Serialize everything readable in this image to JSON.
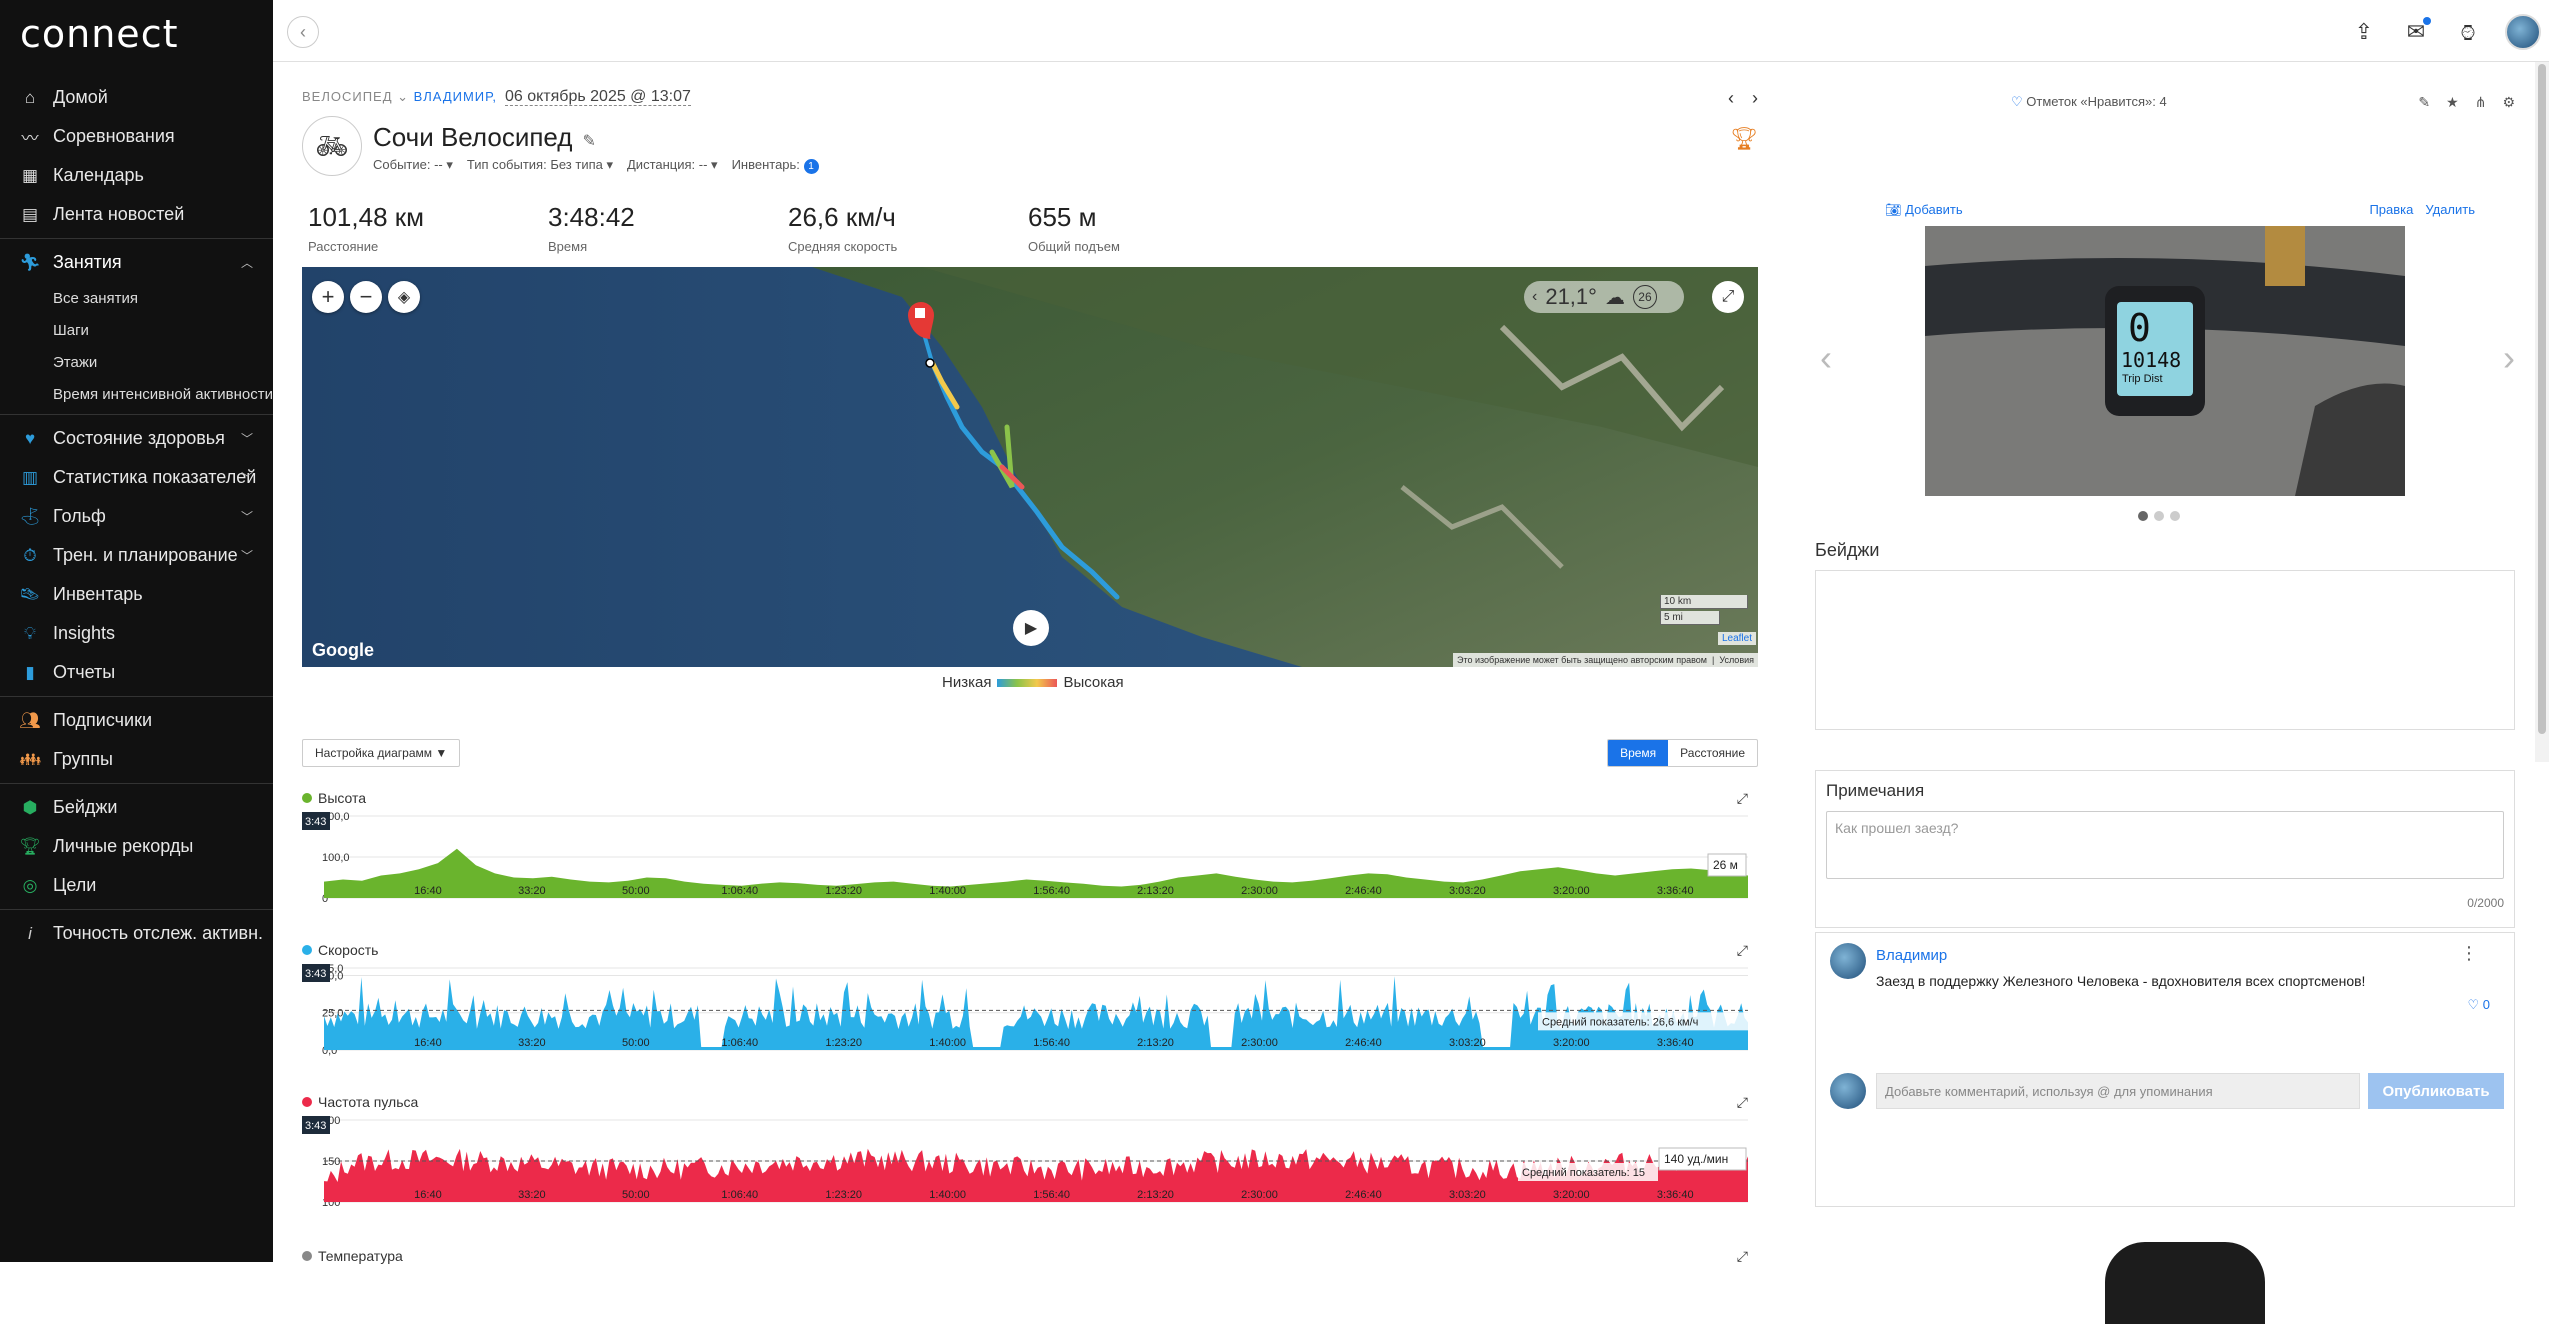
{
  "app": {
    "logo": "connect"
  },
  "nav": {
    "items": [
      {
        "icon": "home-icon",
        "label": "Домой"
      },
      {
        "icon": "challenges-icon",
        "label": "Соревнования"
      },
      {
        "icon": "calendar-icon",
        "label": "Календарь"
      },
      {
        "icon": "newsfeed-icon",
        "label": "Лента новостей"
      }
    ],
    "activities": {
      "label": "Занятия",
      "sub": [
        "Все занятия",
        "Шаги",
        "Этажи",
        "Время интенсивной активности"
      ]
    },
    "group2": [
      {
        "label": "Состояние здоровья",
        "chev": true
      },
      {
        "label": "Статистика показателей",
        "chev": true
      },
      {
        "label": "Гольф",
        "chev": true
      },
      {
        "label": "Трен. и планирование",
        "chev": true
      },
      {
        "label": "Инвентарь"
      },
      {
        "label": "Insights"
      },
      {
        "label": "Отчеты"
      }
    ],
    "group3": [
      {
        "label": "Подписчики"
      },
      {
        "label": "Группы"
      }
    ],
    "group4": [
      {
        "label": "Бейджи"
      },
      {
        "label": "Личные рекорды"
      },
      {
        "label": "Цели"
      }
    ],
    "group5": [
      {
        "label": "Точность отслеж. активн."
      }
    ]
  },
  "activity": {
    "category": "ВЕЛОСИПЕД",
    "user": "ВЛАДИМИР,",
    "date": "06 октябрь 2025 @ 13:07",
    "title": "Сочи Велосипед",
    "event_label": "Событие: --",
    "event_type": "Тип события: Без типа",
    "distance_meta": "Дистанция: --",
    "gear_label": "Инвентарь:",
    "gear_count": "1"
  },
  "stats": [
    {
      "value": "101,48 км",
      "label": "Расстояние"
    },
    {
      "value": "3:48:42",
      "label": "Время"
    },
    {
      "value": "26,6 км/ч",
      "label": "Средняя скорость"
    },
    {
      "value": "655 м",
      "label": "Общий подъем"
    }
  ],
  "map": {
    "temperature": "21,1°",
    "wind": "26",
    "scale_km": "10 km",
    "scale_mi": "5 mi",
    "leaflet": "Leaflet",
    "copyright": "Это изображение может быть защищено авторским правом",
    "terms": "Условия",
    "google": "Google",
    "legend_low": "Низкая",
    "legend_high": "Высокая"
  },
  "chart_controls": {
    "settings": "Настройка диаграмм ▼",
    "time": "Время",
    "distance": "Расстояние"
  },
  "chart_data": [
    {
      "type": "area",
      "title": "Высота",
      "color": "#6ab42d",
      "x_ticks": [
        "16:40",
        "33:20",
        "50:00",
        "1:06:40",
        "1:23:20",
        "1:40:00",
        "1:56:40",
        "2:13:20",
        "2:30:00",
        "2:46:40",
        "3:03:20",
        "3:20:00",
        "3:36:40"
      ],
      "y_ticks": [
        "200,0",
        "100,0",
        "0"
      ],
      "ylim": [
        0,
        200
      ],
      "cursor_label": "3:43",
      "tooltip": "26 м",
      "values": [
        40,
        45,
        42,
        55,
        60,
        70,
        85,
        120,
        80,
        60,
        50,
        48,
        52,
        45,
        40,
        38,
        42,
        50,
        48,
        40,
        35,
        32,
        30,
        35,
        38,
        36,
        32,
        30,
        34,
        38,
        40,
        35,
        30,
        28,
        32,
        36,
        40,
        45,
        42,
        38,
        35,
        30,
        28,
        32,
        40,
        50,
        55,
        60,
        52,
        45,
        40,
        38,
        42,
        48,
        55,
        60,
        58,
        50,
        45,
        40,
        38,
        45,
        55,
        65,
        70,
        75,
        68,
        60,
        55,
        60,
        65,
        70,
        72,
        68,
        60,
        55
      ]
    },
    {
      "type": "area",
      "title": "Скорость",
      "color": "#2ab0e8",
      "x_ticks": [
        "16:40",
        "33:20",
        "50:00",
        "1:06:40",
        "1:23:20",
        "1:40:00",
        "1:56:40",
        "2:13:20",
        "2:30:00",
        "2:46:40",
        "3:03:20",
        "3:20:00",
        "3:36:40"
      ],
      "y_ticks": [
        "55,0",
        "50,0",
        "25,0",
        "0,0"
      ],
      "ylim": [
        0,
        55
      ],
      "avg_value": 26.6,
      "cursor_label": "3:43",
      "avg_label": "Средний показатель: 26,6 км/ч"
    },
    {
      "type": "area",
      "title": "Частота пульса",
      "color": "#ec2a4a",
      "x_ticks": [
        "16:40",
        "33:20",
        "50:00",
        "1:06:40",
        "1:23:20",
        "1:40:00",
        "1:56:40",
        "2:13:20",
        "2:30:00",
        "2:46:40",
        "3:03:20",
        "3:20:00",
        "3:36:40"
      ],
      "y_ticks": [
        "200",
        "150",
        "100"
      ],
      "ylim": [
        100,
        200
      ],
      "avg_value": 150,
      "cursor_label": "3:43",
      "avg_label": "Средний показатель: 15",
      "tooltip": "140 уд./мин"
    }
  ],
  "next_chart": "Температура",
  "right": {
    "likes": "Отметок «Нравится»: 4",
    "add_photo": "Добавить",
    "edit": "Правка",
    "delete": "Удалить",
    "photo_text1": "0",
    "photo_text2": "10148",
    "photo_text3": "Trip Dist",
    "badges_title": "Бейджи",
    "notes_title": "Примечания",
    "notes_placeholder": "Как прошел заезд?",
    "notes_count": "0/2000",
    "comment_user": "Владимир",
    "comment_text": "Заезд в поддержку Железного Человека - вдохновителя всех спортсменов!",
    "comment_likes": "0",
    "comment_placeholder": "Добавьте комментарий, используя @ для упоминания",
    "publish": "Опубликовать"
  }
}
